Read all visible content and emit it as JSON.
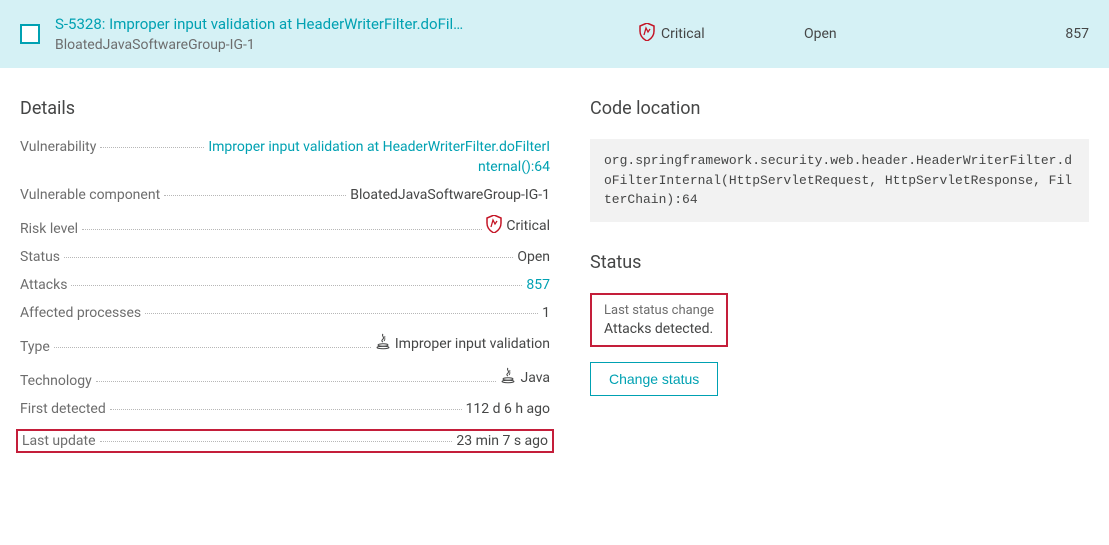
{
  "header": {
    "title": "S-5328: Improper input validation at HeaderWriterFilter.doFil…",
    "subtitle": "BloatedJavaSoftwareGroup-IG-1",
    "severity": "Critical",
    "status": "Open",
    "attacks": "857"
  },
  "details": {
    "heading": "Details",
    "vulnerability_label": "Vulnerability",
    "vulnerability_value_l1": "Improper input validation at HeaderWriterFilter.doFilterI",
    "vulnerability_value_l2": "nternal():64",
    "component_label": "Vulnerable component",
    "component_value": "BloatedJavaSoftwareGroup-IG-1",
    "risk_label": "Risk level",
    "risk_value": "Critical",
    "status_label": "Status",
    "status_value": "Open",
    "attacks_label": "Attacks",
    "attacks_value": "857",
    "processes_label": "Affected processes",
    "processes_value": "1",
    "type_label": "Type",
    "type_value": "Improper input validation",
    "technology_label": "Technology",
    "technology_value": "Java",
    "first_detected_label": "First detected",
    "first_detected_value": "112 d 6 h ago",
    "last_update_label": "Last update",
    "last_update_value": "23 min 7 s ago"
  },
  "code_location": {
    "heading": "Code location",
    "code": "org.springframework.security.web.header.HeaderWriterFilter.doFilterInternal(HttpServletRequest, HttpServletResponse, FilterChain):64"
  },
  "status_section": {
    "heading": "Status",
    "change_label": "Last status change",
    "change_value": "Attacks detected.",
    "button": "Change status"
  }
}
